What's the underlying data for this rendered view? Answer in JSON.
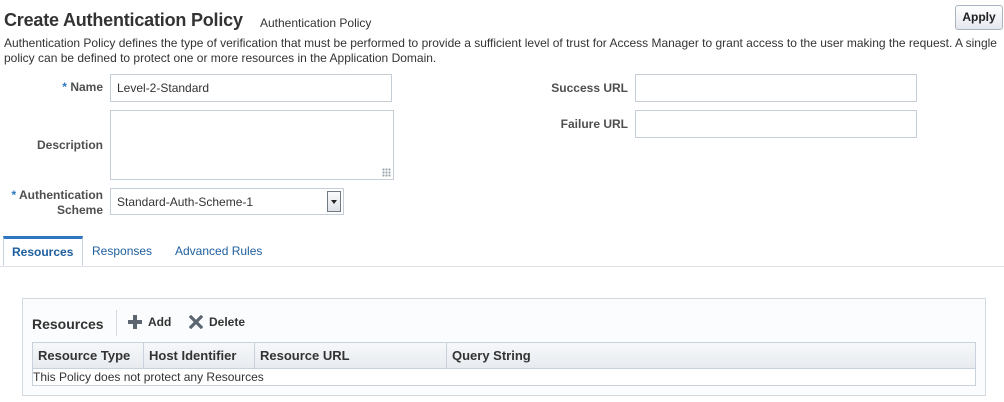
{
  "header": {
    "title": "Create Authentication Policy",
    "subtitle": "Authentication Policy",
    "apply_label": "Apply"
  },
  "description_text": "Authentication Policy defines the type of verification that must be performed to provide a sufficient level of trust for Access Manager to grant access to the user making the request. A single policy can be defined to protect one or more resources in the Application Domain.",
  "form": {
    "required_mark": "*",
    "name": {
      "label": "Name",
      "value": "Level-2-Standard"
    },
    "description": {
      "label": "Description",
      "value": ""
    },
    "auth_scheme": {
      "label_line1": "Authentication",
      "label_line2": "Scheme",
      "value": "Standard-Auth-Scheme-1"
    },
    "success_url": {
      "label": "Success URL",
      "value": ""
    },
    "failure_url": {
      "label": "Failure URL",
      "value": ""
    }
  },
  "tabs": [
    {
      "label": "Resources",
      "active": true
    },
    {
      "label": "Responses",
      "active": false
    },
    {
      "label": "Advanced Rules",
      "active": false
    }
  ],
  "resources": {
    "title": "Resources",
    "add_label": "Add",
    "delete_label": "Delete",
    "columns": [
      "Resource Type",
      "Host Identifier",
      "Resource URL",
      "Query String"
    ],
    "empty_message": "This Policy does not protect any Resources"
  },
  "colors": {
    "accent": "#2e77c0",
    "link": "#1d5e9e",
    "add_icon": "#5b6670",
    "delete_icon": "#5b6670"
  }
}
